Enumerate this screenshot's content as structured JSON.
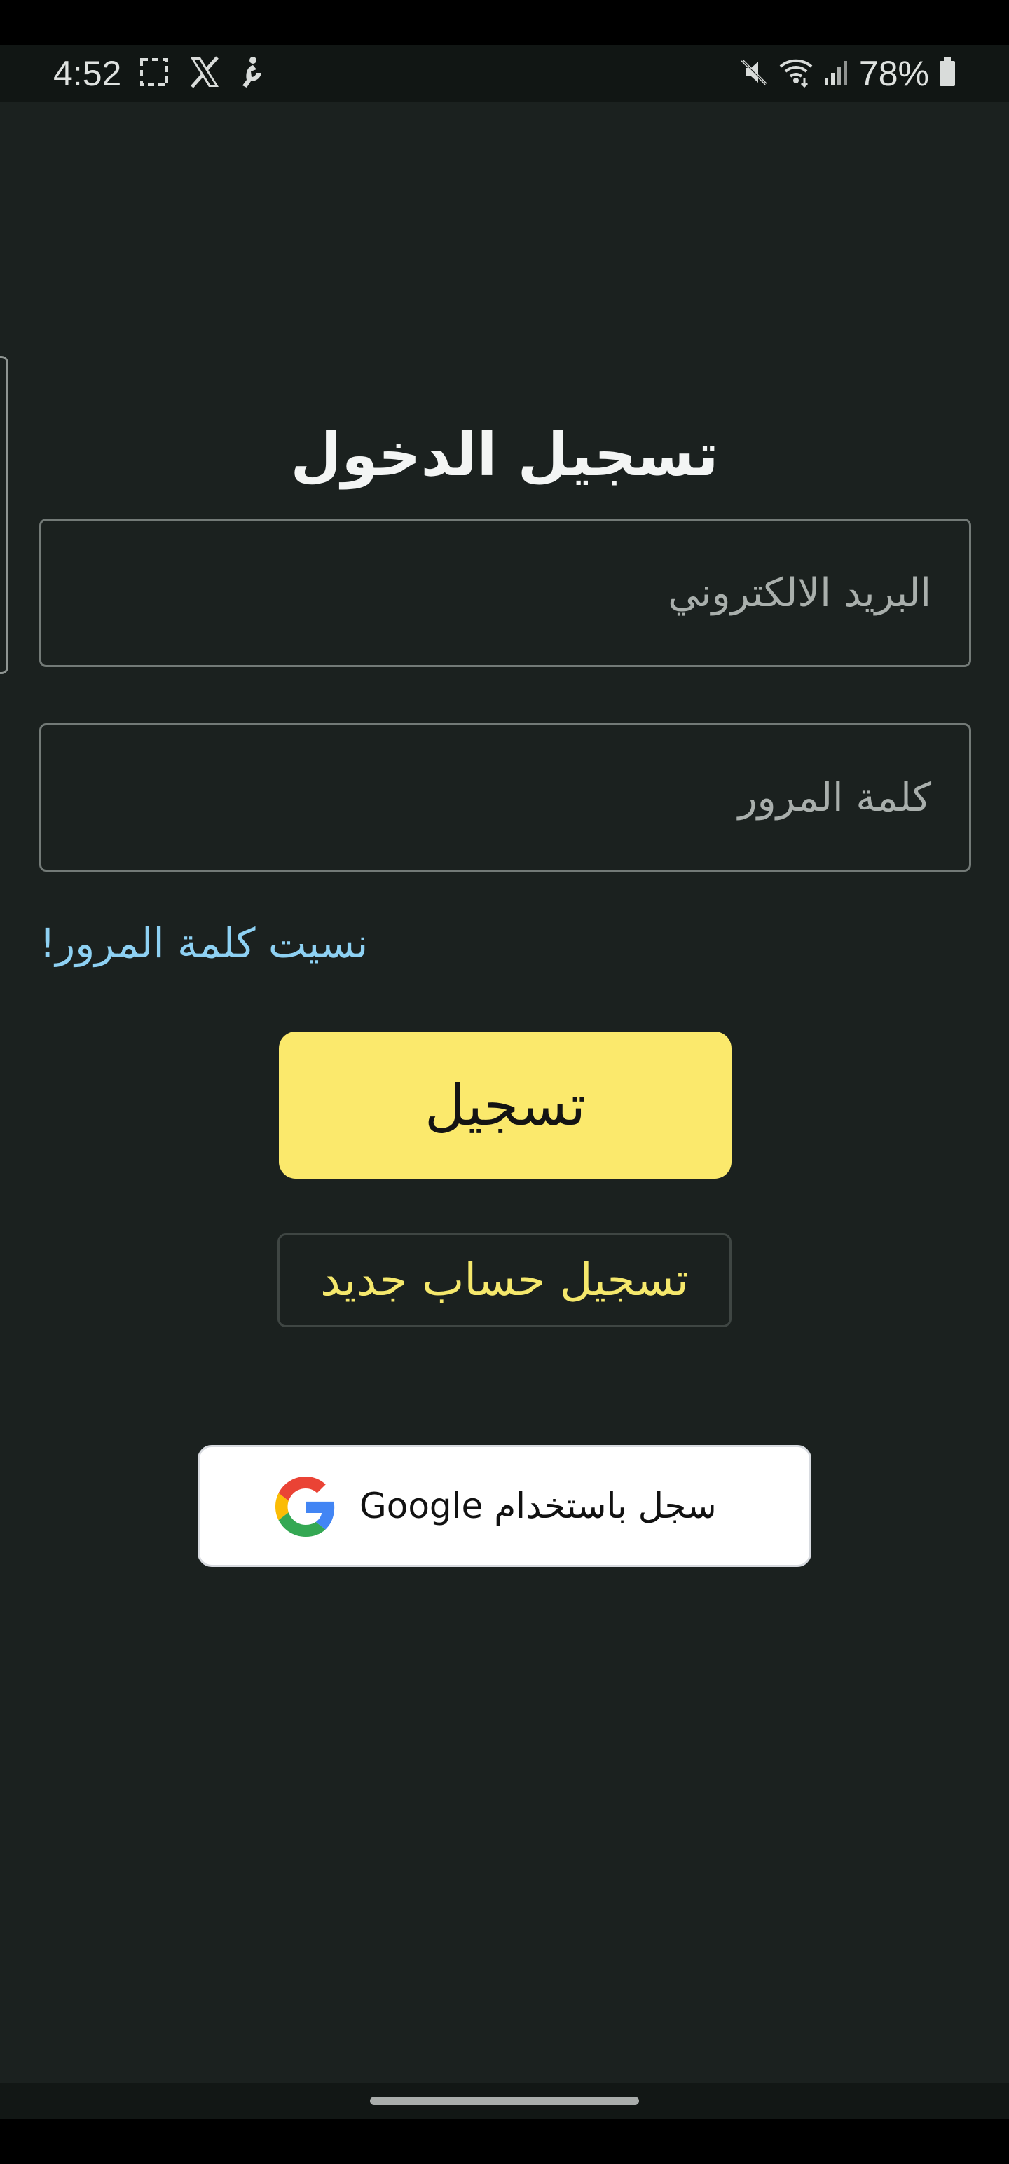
{
  "status_bar": {
    "time": "4:52",
    "battery": "78%",
    "icons": [
      "screenshot-icon",
      "x-logo-icon",
      "accessibility-icon",
      "mute-icon",
      "wifi-icon",
      "signal-icon",
      "battery-icon"
    ]
  },
  "login": {
    "title": "تسجيل الدخول",
    "email_placeholder": "البريد الالكتروني",
    "password_placeholder": "كلمة المرور",
    "forgot_password": "نسيت كلمة المرور!",
    "login_button": "تسجيل",
    "register_button": "تسجيل حساب جديد",
    "google_button": "سجل باستخدام Google"
  },
  "colors": {
    "background": "#1b211f",
    "accent_yellow": "#fbe96c",
    "link_blue": "#8ed1f3",
    "google_blue": "#4285F4",
    "google_red": "#EA4335",
    "google_yellow": "#FBBC05",
    "google_green": "#34A853"
  }
}
